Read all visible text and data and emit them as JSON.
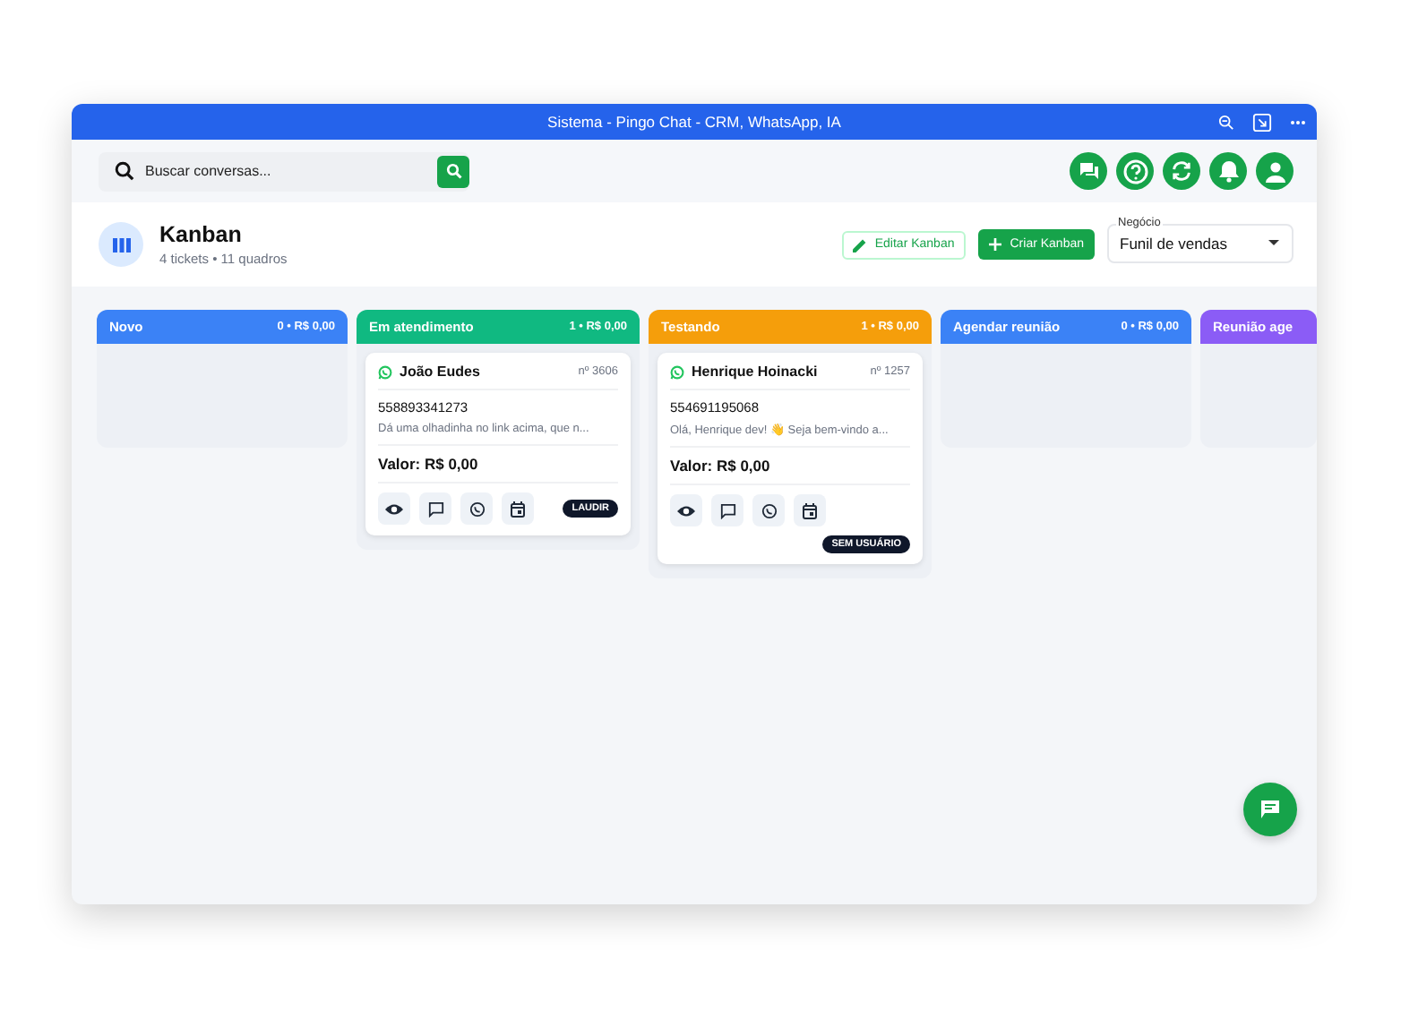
{
  "window": {
    "title": "Sistema - Pingo Chat - CRM, WhatsApp, IA"
  },
  "search": {
    "placeholder": "Buscar conversas..."
  },
  "page": {
    "title": "Kanban",
    "subtitle": "4 tickets • 11 quadros"
  },
  "actions": {
    "edit": "Editar Kanban",
    "create": "Criar Kanban"
  },
  "business_select": {
    "label": "Negócio",
    "value": "Funil de vendas"
  },
  "columns": [
    {
      "title": "Novo",
      "count": "0 • R$ 0,00",
      "color": "#3b82f6"
    },
    {
      "title": "Em atendimento",
      "count": "1 • R$ 0,00",
      "color": "#10b981",
      "cards": [
        {
          "name": "João Eudes",
          "number": "nº 3606",
          "phone": "558893341273",
          "preview": "Dá uma olhadinha no link acima, que n...",
          "value": "Valor: R$ 0,00",
          "tag": "LAUDIR"
        }
      ]
    },
    {
      "title": "Testando",
      "count": "1 • R$ 0,00",
      "color": "#f59e0b",
      "cards": [
        {
          "name": "Henrique Hoinacki",
          "number": "nº 1257",
          "phone": "554691195068",
          "preview": "Olá, Henrique dev! 👋 Seja bem-vindo a...",
          "value": "Valor: R$ 0,00",
          "tag": "SEM USUÁRIO"
        }
      ]
    },
    {
      "title": "Agendar reunião",
      "count": "0 • R$ 0,00",
      "color": "#3b82f6"
    },
    {
      "title": "Reunião age",
      "color": "#8b5cf6"
    }
  ]
}
